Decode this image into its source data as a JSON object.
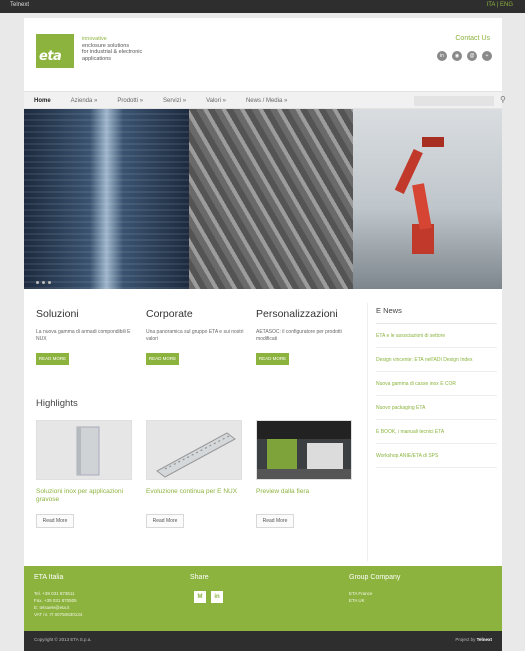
{
  "topbar": {
    "brand": "Telnext",
    "lang": "ITA | ENG"
  },
  "header": {
    "logo": "eta",
    "tagline": "innovative",
    "tagline_lines": [
      "enclosure solutions",
      "for industrial & electronic",
      "applications"
    ],
    "contact": "Contact Us",
    "social": [
      "linkedin-icon",
      "rss-icon",
      "email-icon",
      "plus-icon"
    ]
  },
  "nav": {
    "items": [
      "Home",
      "Azienda »",
      "Prodotti »",
      "Servizi »",
      "Valori »",
      "News / Media »"
    ]
  },
  "columns": [
    {
      "title": "Soluzioni",
      "text": "La nuova gamma di armadi compondibili E NUX",
      "button": "READ MORE"
    },
    {
      "title": "Corporate",
      "text": "Una panoramica sul gruppo ETA e sui nostri valori",
      "button": "READ MORE"
    },
    {
      "title": "Personalizzazioni",
      "text": "AETASOC: il configuratore per prodotti modificati",
      "button": "READ MORE"
    }
  ],
  "highlights": {
    "title": "Highlights",
    "cards": [
      {
        "caption": "Soluzioni inox per applicazioni gravose",
        "button": "Read More"
      },
      {
        "caption": "Evoluzione continua per E NUX",
        "button": "Read More"
      },
      {
        "caption": "Preview dalla fiera",
        "button": "Read More"
      }
    ]
  },
  "news": {
    "title": "E News",
    "items": [
      "ETA e le associazioni di settore",
      "Design vincente: ETA nell'ADI Design Index",
      "Nuova gamma di casse inox E COR",
      "Nuovo packaging ETA",
      "E BOOK, i manuali tecnici ETA",
      "Workshop ANIE/ETA di SPS"
    ]
  },
  "footer": {
    "company_title": "ETA Italia",
    "company_lines": [
      "Tel. +39 031 873611",
      "Fax. +39 031 870505",
      "E: telsaele@eta.it",
      "VAT nr. IT 00750630134"
    ],
    "share_title": "Share",
    "group_title": "Group Company",
    "group_lines": [
      "ETA France",
      "ETA UK"
    ]
  },
  "bottom": {
    "copyright": "Copyright © 2013 ETA S.p.a.",
    "project_prefix": "Project by ",
    "project_by": "Telnext"
  },
  "colors": {
    "accent": "#8cb33e",
    "dark": "#2e2e2e"
  }
}
